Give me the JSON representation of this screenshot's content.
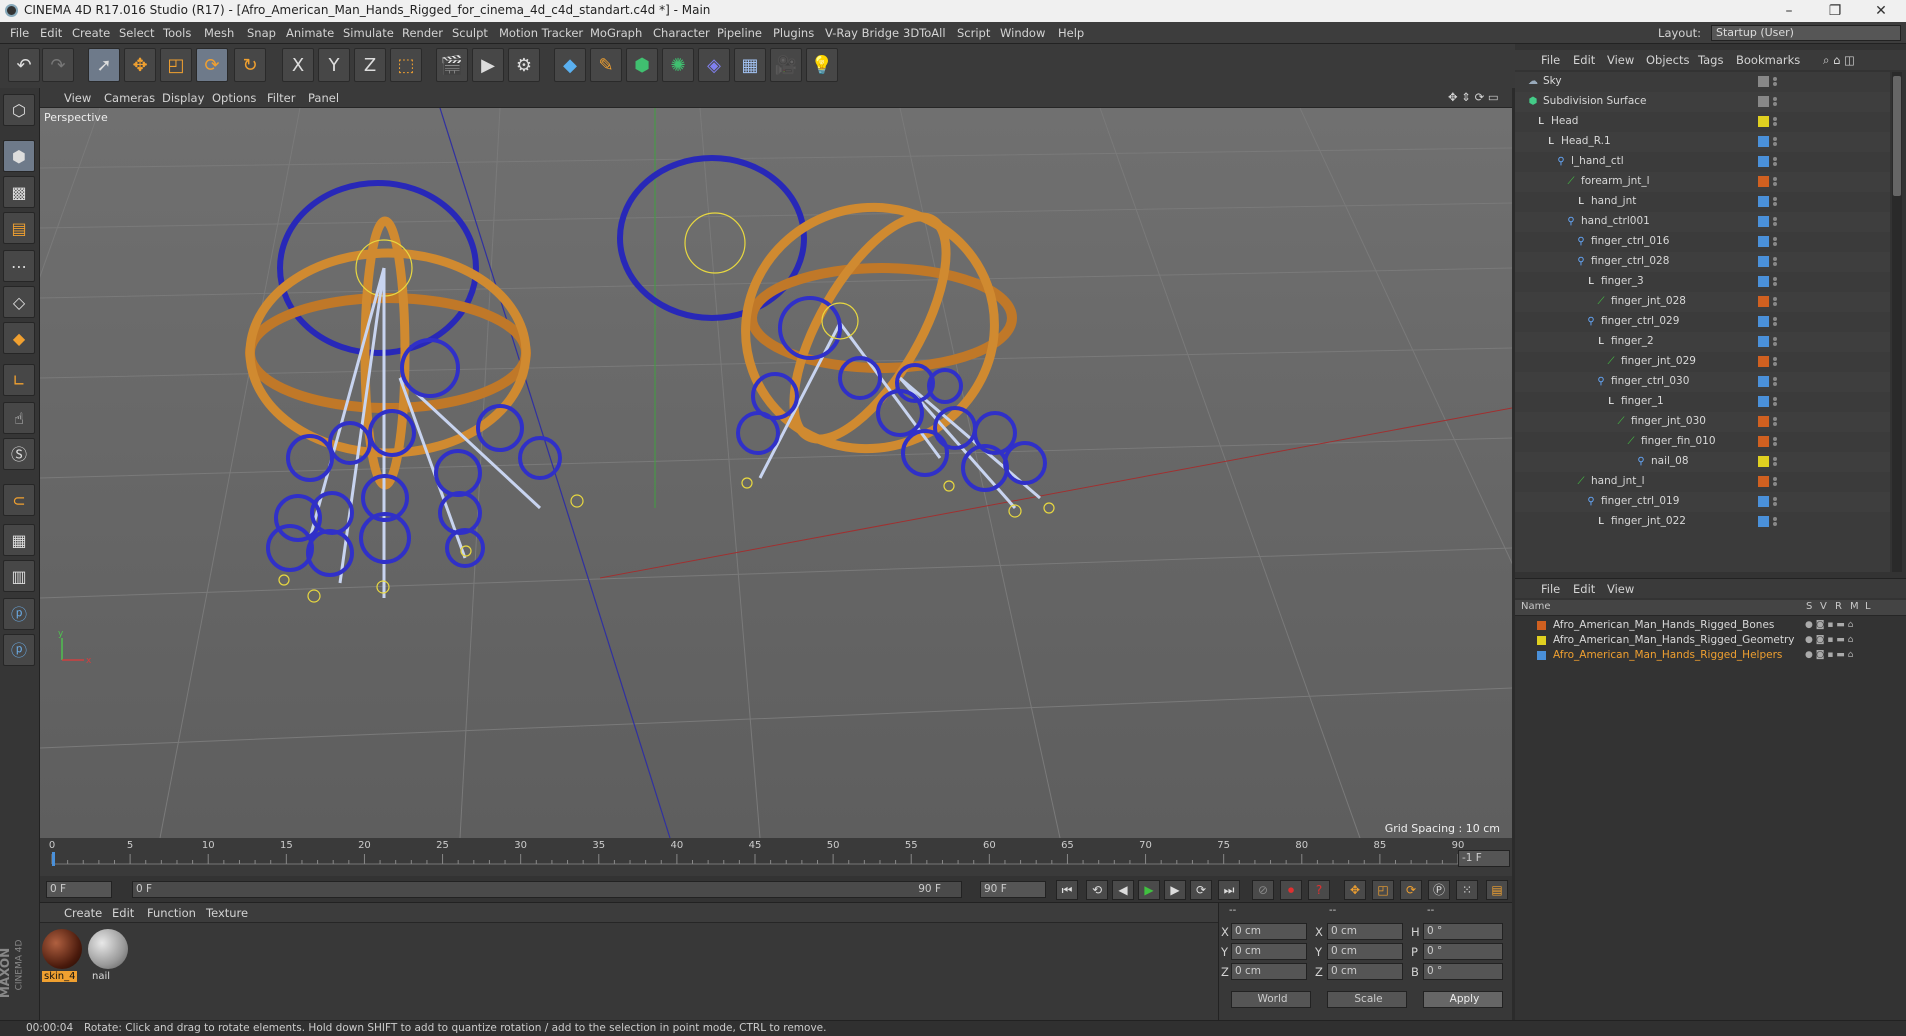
{
  "window": {
    "title": "CINEMA 4D R17.016 Studio (R17) - [Afro_American_Man_Hands_Rigged_for_cinema_4d_c4d_standart.c4d *] - Main",
    "minimize": "–",
    "restore": "❐",
    "close": "✕"
  },
  "menu": [
    "File",
    "Edit",
    "Create",
    "Select",
    "Tools",
    "Mesh",
    "Snap",
    "Animate",
    "Simulate",
    "Render",
    "Sculpt",
    "Motion Tracker",
    "MoGraph",
    "Character",
    "Pipeline",
    "Plugins",
    "V-Ray Bridge",
    "3DToAll",
    "Script",
    "Window",
    "Help"
  ],
  "layout": {
    "label": "Layout:",
    "value": "Startup (User)"
  },
  "toolbar": {
    "icons": [
      "undo-icon",
      "redo-icon",
      "select-arrow-icon",
      "move-icon",
      "scale-icon",
      "rotate-icon",
      "rotate2-icon",
      "x-axis-icon",
      "y-axis-icon",
      "z-axis-icon",
      "coordinate-icon",
      "render-region-icon",
      "render-view-icon",
      "render-settings-icon",
      "cube-icon",
      "pen-icon",
      "subdivision-icon",
      "array-icon",
      "deformer-icon",
      "floor-icon",
      "camera-icon",
      "light-icon"
    ],
    "x": "X",
    "y": "Y",
    "z": "Z"
  },
  "viewport": {
    "menu": [
      "View",
      "Cameras",
      "Display",
      "Options",
      "Filter",
      "Panel"
    ],
    "label": "Perspective",
    "grid_spacing": "Grid Spacing : 10 cm",
    "axis_y": "y",
    "axis_x": "x"
  },
  "timeline": {
    "ticks": [
      "0",
      "5",
      "10",
      "15",
      "20",
      "25",
      "30",
      "35",
      "40",
      "45",
      "50",
      "55",
      "60",
      "65",
      "70",
      "75",
      "80",
      "85",
      "90"
    ],
    "current": "-1 F"
  },
  "controls": {
    "start": "0 F",
    "range_start": "0 F",
    "range_end": "90 F",
    "end": "90 F"
  },
  "materials": {
    "menu": [
      "Create",
      "Edit",
      "Function",
      "Texture"
    ],
    "items": [
      {
        "name": "skin_4"
      },
      {
        "name": "nail"
      }
    ]
  },
  "coords": {
    "headers": [
      "--",
      "--",
      "--"
    ],
    "rows": [
      {
        "a": "X",
        "av": "0 cm",
        "b": "X",
        "bv": "0 cm",
        "c": "H",
        "cv": "0 °"
      },
      {
        "a": "Y",
        "av": "0 cm",
        "b": "Y",
        "bv": "0 cm",
        "c": "P",
        "cv": "0 °"
      },
      {
        "a": "Z",
        "av": "0 cm",
        "b": "Z",
        "bv": "0 cm",
        "c": "B",
        "cv": "0 °"
      }
    ],
    "world": "World",
    "scale": "Scale",
    "apply": "Apply"
  },
  "status": {
    "time": "00:00:04",
    "text": "Rotate: Click and drag to rotate elements. Hold down SHIFT to add to quantize rotation / add to the selection in point mode, CTRL to remove."
  },
  "objects": {
    "menu": [
      "File",
      "Edit",
      "View",
      "Objects",
      "Tags",
      "Bookmarks"
    ],
    "rows": [
      {
        "name": "Sky",
        "tag": "#888888"
      },
      {
        "name": "Subdivision Surface",
        "tag": "#888888"
      },
      {
        "name": "Head",
        "tag": "#e0d020"
      },
      {
        "name": "Head_R.1",
        "tag": "#4a90d9"
      },
      {
        "name": "l_hand_ctl",
        "tag": "#4a90d9"
      },
      {
        "name": "forearm_jnt_l",
        "tag": "#d06020"
      },
      {
        "name": "hand_jnt",
        "tag": "#4a90d9"
      },
      {
        "name": "hand_ctrl001",
        "tag": "#4a90d9"
      },
      {
        "name": "finger_ctrl_016",
        "tag": "#4a90d9"
      },
      {
        "name": "finger_ctrl_028",
        "tag": "#4a90d9"
      },
      {
        "name": "finger_3",
        "tag": "#4a90d9"
      },
      {
        "name": "finger_jnt_028",
        "tag": "#d06020"
      },
      {
        "name": "finger_ctrl_029",
        "tag": "#4a90d9"
      },
      {
        "name": "finger_2",
        "tag": "#4a90d9"
      },
      {
        "name": "finger_jnt_029",
        "tag": "#d06020"
      },
      {
        "name": "finger_ctrl_030",
        "tag": "#4a90d9"
      },
      {
        "name": "finger_1",
        "tag": "#4a90d9"
      },
      {
        "name": "finger_jnt_030",
        "tag": "#d06020"
      },
      {
        "name": "finger_fin_010",
        "tag": "#d06020"
      },
      {
        "name": "nail_08",
        "tag": "#e0d020"
      },
      {
        "name": "hand_jnt_l",
        "tag": "#d06020"
      },
      {
        "name": "finger_ctrl_019",
        "tag": "#4a90d9"
      },
      {
        "name": "finger_jnt_022",
        "tag": "#4a90d9"
      }
    ]
  },
  "layers": {
    "menu": [
      "File",
      "Edit",
      "View"
    ],
    "header": {
      "name": "Name",
      "cols": [
        "S",
        "V",
        "R",
        "M",
        "L"
      ]
    },
    "rows": [
      {
        "name": "Afro_American_Man_Hands_Rigged_Bones",
        "color": "#d06020"
      },
      {
        "name": "Afro_American_Man_Hands_Rigged_Geometry",
        "color": "#e0d020"
      },
      {
        "name": "Afro_American_Man_Hands_Rigged_Helpers",
        "color": "#4a90d9"
      }
    ]
  },
  "brand": {
    "maxon": "MAXON",
    "cinema": "CINEMA 4D"
  }
}
